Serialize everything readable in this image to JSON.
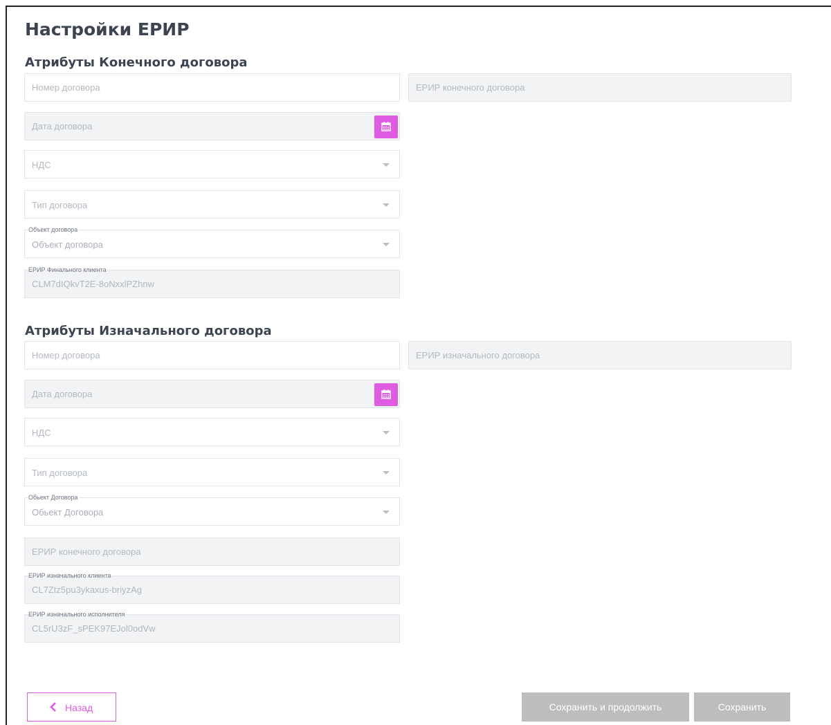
{
  "page_title": "Настройки ЕРИР",
  "final_contract": {
    "section_title": "Атрибуты Конечного договора",
    "contract_number_placeholder": "Номер договора",
    "erir_contract_placeholder": "ЕРИР конечного договора",
    "contract_date_placeholder": "Дата договора",
    "vat_placeholder": "НДС",
    "contract_type_placeholder": "Тип договора",
    "contract_object_label": "Объект договора",
    "contract_object_placeholder": "Объект договора",
    "final_client_erir_label": "ЕРИР Финального клиента",
    "final_client_erir_value": "CLM7dIQkvT2E-8oNxxlPZhnw"
  },
  "initial_contract": {
    "section_title": "Атрибуты Изначального договора",
    "contract_number_placeholder": "Номер договора",
    "erir_contract_placeholder": "ЕРИР изначального договора",
    "contract_date_placeholder": "Дата договора",
    "vat_placeholder": "НДС",
    "contract_type_placeholder": "Тип договора",
    "contract_object_label": "Обьект Договора",
    "contract_object_placeholder": "Обьект Договора",
    "final_contract_erir_placeholder": "ЕРИР конечного договора",
    "initial_client_erir_label": "ЕРИР изначального клиента",
    "initial_client_erir_value": "CL7Ztz5pu3ykaxus-briyzAg",
    "initial_executor_erir_label": "ЕРИР изначального исполнителя",
    "initial_executor_erir_value": "CL5rU3zF_sPEK97EJol0odVw"
  },
  "footer": {
    "back_label": "Назад",
    "save_continue_label": "Сохранить и продолжить",
    "save_label": "Сохранить"
  },
  "colors": {
    "accent": "#df5ce2",
    "disabled_button": "#bdbdbd",
    "readonly_field": "#f1f3f5"
  }
}
